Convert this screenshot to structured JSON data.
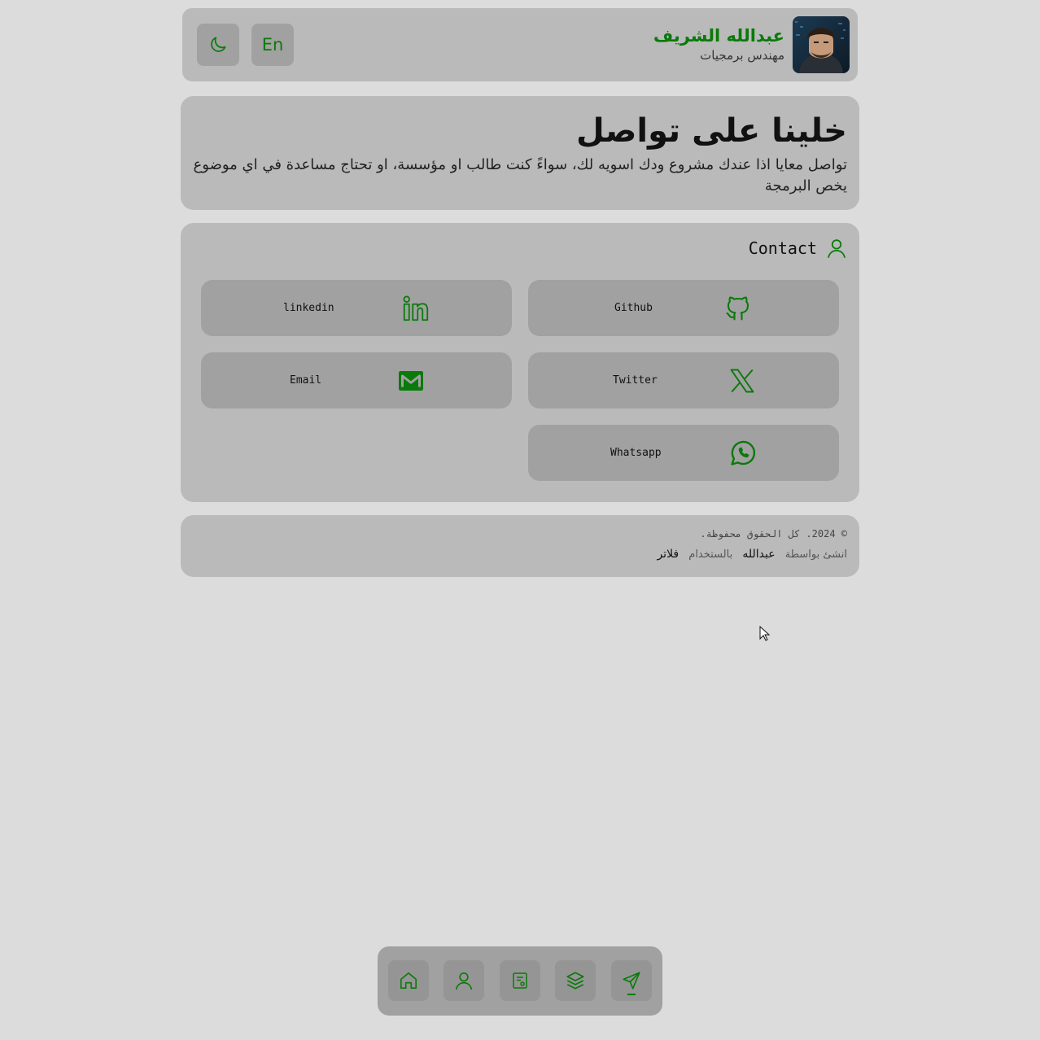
{
  "header": {
    "name": "عبدالله الشريف",
    "role": "مهندس برمجيات",
    "lang_button": "En",
    "theme_icon": "moon-icon"
  },
  "hero": {
    "title": "خلينا على تواصل",
    "description": "تواصل معايا اذا عندك مشروع ودك اسويه لك، سواءً كنت طالب او مؤسسة، او تحتاج مساعدة في اي موضوع يخص البرمجة"
  },
  "contact": {
    "title": "Contact",
    "links": [
      {
        "label": "Github",
        "icon": "github-icon"
      },
      {
        "label": "linkedin",
        "icon": "linkedin-icon"
      },
      {
        "label": "Twitter",
        "icon": "x-twitter-icon"
      },
      {
        "label": "Email",
        "icon": "gmail-icon"
      },
      {
        "label": "Whatsapp",
        "icon": "whatsapp-icon"
      }
    ]
  },
  "footer": {
    "copyright": "© 2024. كل الحقوق محفوظة.",
    "made_by": "انشئ بواسطة",
    "author": "عبدالله",
    "using": "بالستخدام",
    "tool": "فلاتر"
  },
  "nav": {
    "items": [
      "home-icon",
      "user-icon",
      "certificate-icon",
      "layers-icon",
      "send-icon"
    ],
    "active": "send-icon"
  },
  "colors": {
    "accent": "#0a7a0a",
    "background": "#dcdcdc",
    "card": "#bababa",
    "button": "#a1a1a1"
  }
}
